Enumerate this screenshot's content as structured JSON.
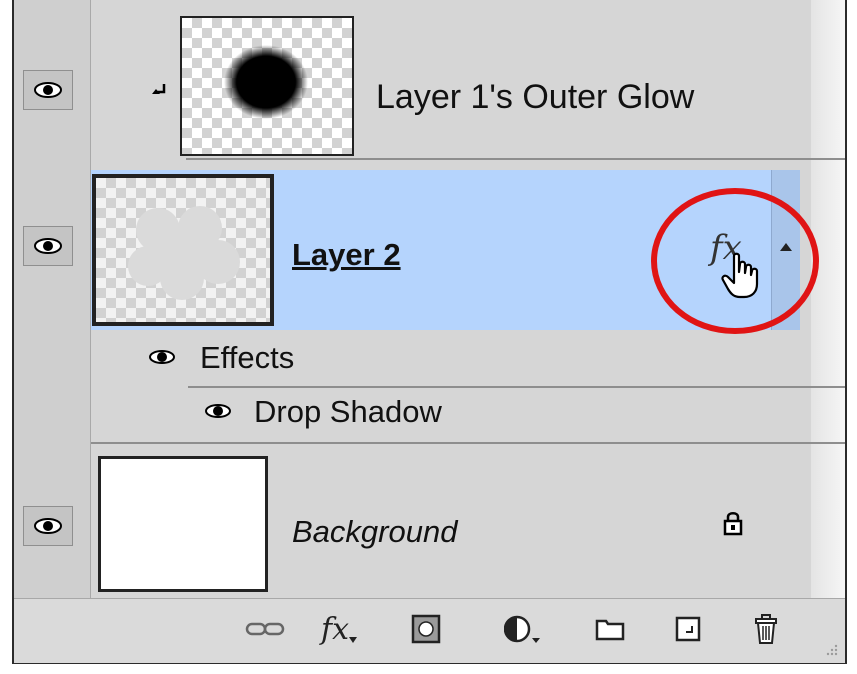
{
  "layers": [
    {
      "name": "Layer 1's Outer Glow",
      "state": "clipped"
    },
    {
      "name": "Layer 2",
      "state": "selected",
      "fx_label": "fx"
    },
    {
      "name": "Background",
      "state": "locked"
    }
  ],
  "effects": {
    "label": "Effects",
    "items": [
      "Drop Shadow"
    ]
  },
  "footer": {
    "tools": [
      "link-layers",
      "add-layer-style",
      "add-layer-mask",
      "new-adjustment-layer",
      "new-group",
      "new-layer",
      "delete-layer"
    ],
    "fx_text": "fx"
  },
  "colors": {
    "panel_bg": "#d6d6d6",
    "selection": "#b5d4fd",
    "highlight_circle": "#e01414"
  }
}
